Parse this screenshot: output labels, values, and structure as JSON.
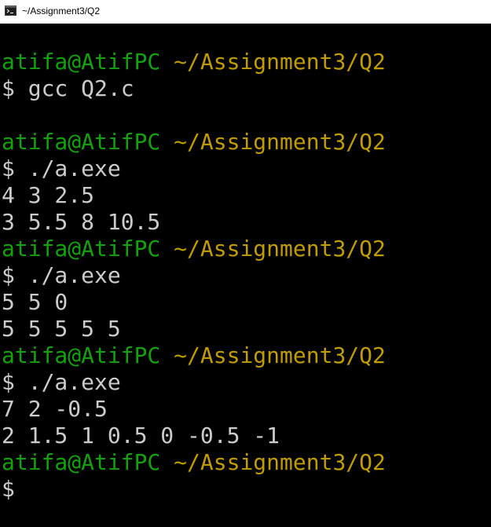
{
  "window": {
    "title": "~/Assignment3/Q2",
    "icon": "terminal-icon"
  },
  "colors": {
    "background": "#000000",
    "prompt_user": "#13a10e",
    "prompt_path": "#c19c00",
    "text": "#cccccc"
  },
  "terminal": {
    "lines": [
      {
        "kind": "prompt",
        "user": "atifa@AtifPC",
        "path": "~/Assignment3/Q2"
      },
      {
        "kind": "text",
        "text": "$ gcc Q2.c"
      },
      {
        "kind": "blank",
        "text": ""
      },
      {
        "kind": "prompt",
        "user": "atifa@AtifPC",
        "path": "~/Assignment3/Q2"
      },
      {
        "kind": "text",
        "text": "$ ./a.exe"
      },
      {
        "kind": "text",
        "text": "4 3 2.5"
      },
      {
        "kind": "text",
        "text": "3 5.5 8 10.5"
      },
      {
        "kind": "prompt",
        "user": "atifa@AtifPC",
        "path": "~/Assignment3/Q2"
      },
      {
        "kind": "text",
        "text": "$ ./a.exe"
      },
      {
        "kind": "text",
        "text": "5 5 0"
      },
      {
        "kind": "text",
        "text": "5 5 5 5 5"
      },
      {
        "kind": "prompt",
        "user": "atifa@AtifPC",
        "path": "~/Assignment3/Q2"
      },
      {
        "kind": "text",
        "text": "$ ./a.exe"
      },
      {
        "kind": "text",
        "text": "7 2 -0.5"
      },
      {
        "kind": "text",
        "text": "2 1.5 1 0.5 0 -0.5 -1"
      },
      {
        "kind": "prompt",
        "user": "atifa@AtifPC",
        "path": "~/Assignment3/Q2"
      },
      {
        "kind": "text",
        "text": "$"
      }
    ]
  }
}
